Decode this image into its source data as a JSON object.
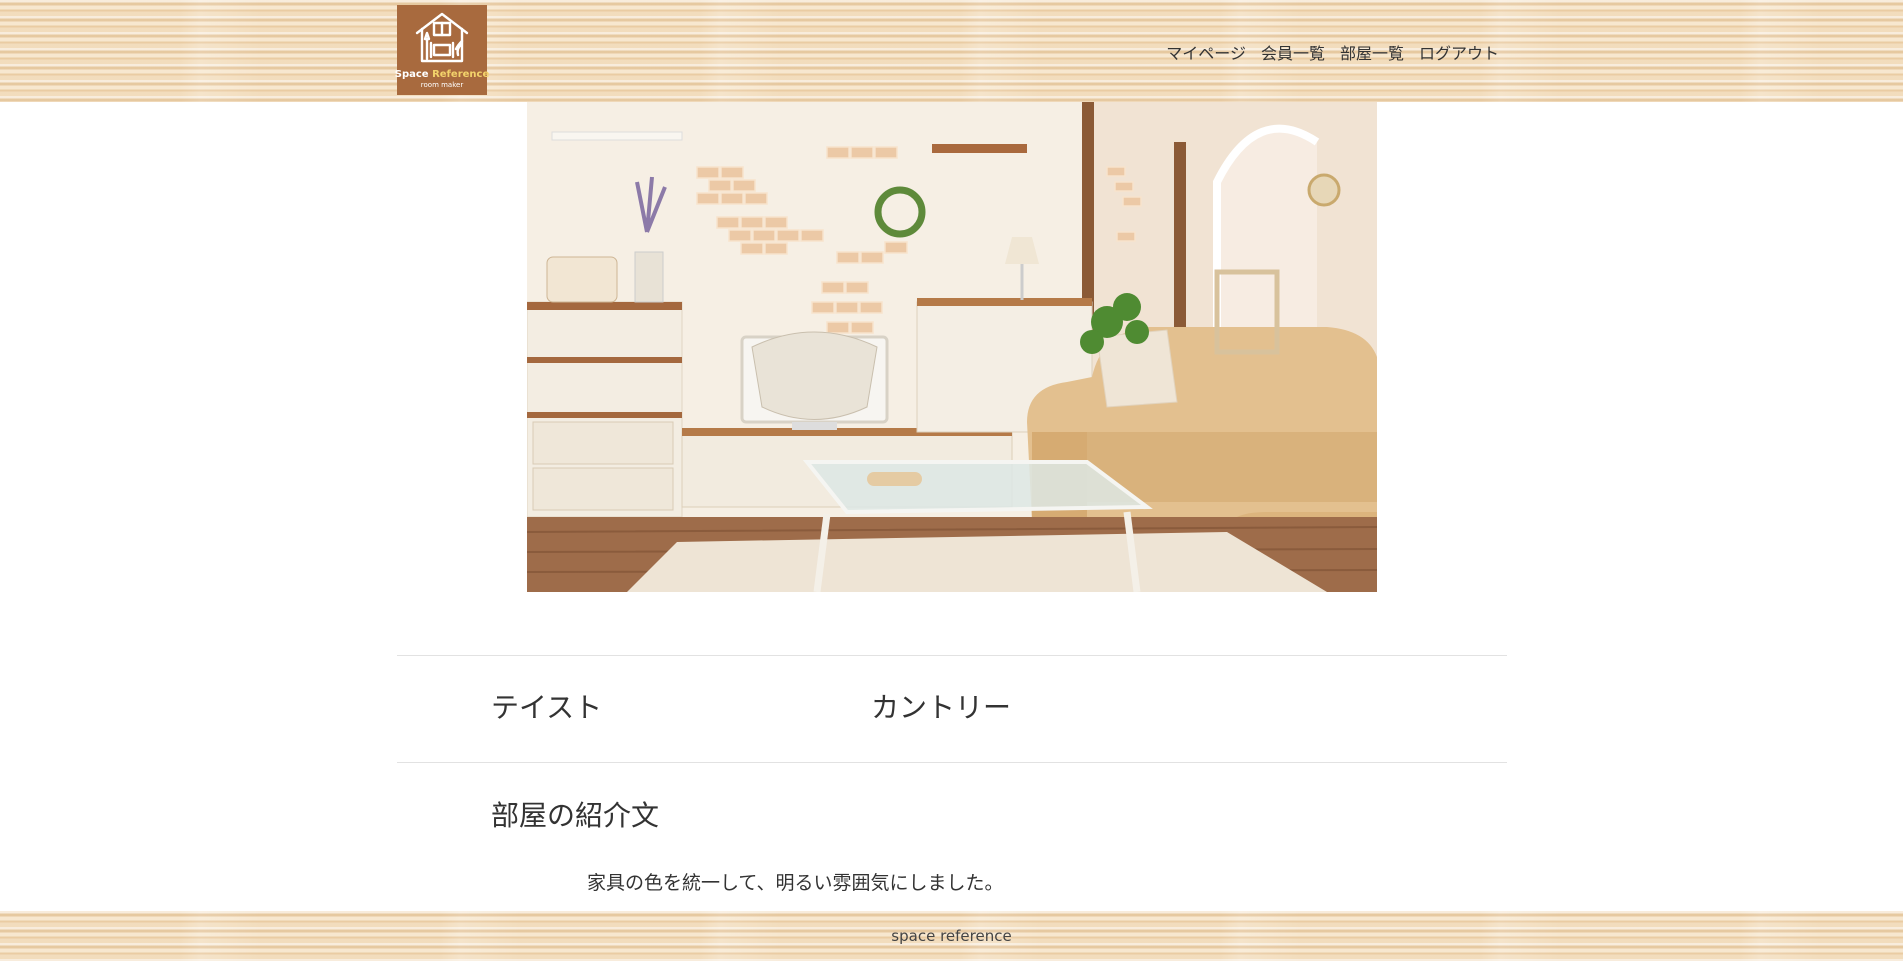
{
  "header": {
    "logo": {
      "title_part1": "Space ",
      "title_part2": "Reference",
      "subtitle": "room maker",
      "icon": "house-furniture-icon",
      "bg_color": "#a86a3e",
      "accent_color": "#f3d36b"
    },
    "nav": {
      "mypage": "マイページ",
      "members": "会員一覧",
      "rooms": "部屋一覧",
      "logout": "ログアウト"
    }
  },
  "main": {
    "room_image": "living-room-photo",
    "taste_label": "テイスト",
    "taste_value": "カントリー",
    "intro_heading": "部屋の紹介文",
    "intro_text": "家具の色を統一して、明るい雰囲気にしました。"
  },
  "footer": {
    "text": "space reference"
  }
}
